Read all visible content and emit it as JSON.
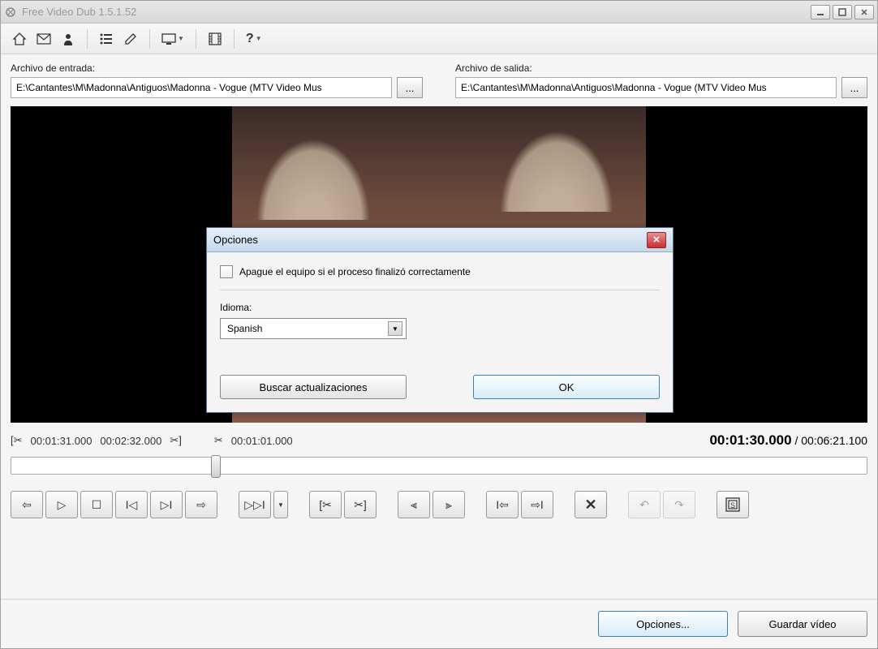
{
  "window": {
    "title": "Free Video Dub 1.5.1.52"
  },
  "files": {
    "input_label": "Archivo de entrada:",
    "input_value": "E:\\Cantantes\\M\\Madonna\\Antiguos\\Madonna - Vogue (MTV Video Mus",
    "output_label": "Archivo de salida:",
    "output_value": "E:\\Cantantes\\M\\Madonna\\Antiguos\\Madonna - Vogue (MTV Video Mus",
    "browse": "..."
  },
  "time": {
    "sel_start": "00:01:31.000",
    "sel_end": "00:02:32.000",
    "sel_dur": "00:01:01.000",
    "current": "00:01:30.000",
    "total_sep": " / ",
    "total": "00:06:21.100"
  },
  "footer": {
    "options": "Opciones...",
    "save": "Guardar vídeo"
  },
  "dialog": {
    "title": "Opciones",
    "shutdown_label": "Apague el equipo si el proceso finalizó correctamente",
    "lang_label": "Idioma:",
    "lang_value": "Spanish",
    "updates": "Buscar actualizaciones",
    "ok": "OK"
  }
}
